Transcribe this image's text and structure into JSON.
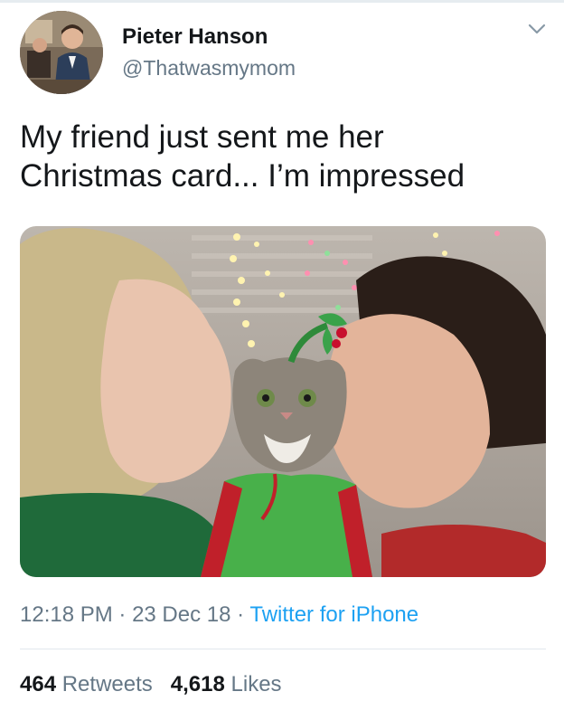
{
  "user": {
    "name": "Pieter Hanson",
    "handle": "@Thatwasmymom"
  },
  "tweet": {
    "line1": "My friend just sent me her",
    "line2": "Christmas card... I’m impressed"
  },
  "meta": {
    "time": "12:18 PM",
    "sep1": " · ",
    "date": "23 Dec 18",
    "sep2": " · ",
    "source": "Twitter for iPhone"
  },
  "stats": {
    "retweets_count": "464",
    "retweets_label": "Retweets",
    "likes_count": "4,618",
    "likes_label": "Likes"
  },
  "icons": {
    "menu": "chevron-down-icon"
  },
  "colors": {
    "text": "#14171a",
    "secondary": "#657786",
    "link": "#1da1f2",
    "divider": "#e1e8ed"
  }
}
